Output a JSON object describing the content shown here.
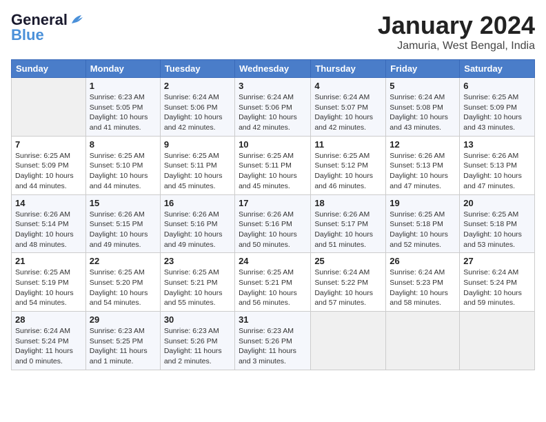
{
  "logo": {
    "line1": "General",
    "line2": "Blue"
  },
  "title": "January 2024",
  "location": "Jamuria, West Bengal, India",
  "headers": [
    "Sunday",
    "Monday",
    "Tuesday",
    "Wednesday",
    "Thursday",
    "Friday",
    "Saturday"
  ],
  "weeks": [
    [
      {
        "day": "",
        "info": ""
      },
      {
        "day": "1",
        "info": "Sunrise: 6:23 AM\nSunset: 5:05 PM\nDaylight: 10 hours\nand 41 minutes."
      },
      {
        "day": "2",
        "info": "Sunrise: 6:24 AM\nSunset: 5:06 PM\nDaylight: 10 hours\nand 42 minutes."
      },
      {
        "day": "3",
        "info": "Sunrise: 6:24 AM\nSunset: 5:06 PM\nDaylight: 10 hours\nand 42 minutes."
      },
      {
        "day": "4",
        "info": "Sunrise: 6:24 AM\nSunset: 5:07 PM\nDaylight: 10 hours\nand 42 minutes."
      },
      {
        "day": "5",
        "info": "Sunrise: 6:24 AM\nSunset: 5:08 PM\nDaylight: 10 hours\nand 43 minutes."
      },
      {
        "day": "6",
        "info": "Sunrise: 6:25 AM\nSunset: 5:09 PM\nDaylight: 10 hours\nand 43 minutes."
      }
    ],
    [
      {
        "day": "7",
        "info": "Sunrise: 6:25 AM\nSunset: 5:09 PM\nDaylight: 10 hours\nand 44 minutes."
      },
      {
        "day": "8",
        "info": "Sunrise: 6:25 AM\nSunset: 5:10 PM\nDaylight: 10 hours\nand 44 minutes."
      },
      {
        "day": "9",
        "info": "Sunrise: 6:25 AM\nSunset: 5:11 PM\nDaylight: 10 hours\nand 45 minutes."
      },
      {
        "day": "10",
        "info": "Sunrise: 6:25 AM\nSunset: 5:11 PM\nDaylight: 10 hours\nand 45 minutes."
      },
      {
        "day": "11",
        "info": "Sunrise: 6:25 AM\nSunset: 5:12 PM\nDaylight: 10 hours\nand 46 minutes."
      },
      {
        "day": "12",
        "info": "Sunrise: 6:26 AM\nSunset: 5:13 PM\nDaylight: 10 hours\nand 47 minutes."
      },
      {
        "day": "13",
        "info": "Sunrise: 6:26 AM\nSunset: 5:13 PM\nDaylight: 10 hours\nand 47 minutes."
      }
    ],
    [
      {
        "day": "14",
        "info": "Sunrise: 6:26 AM\nSunset: 5:14 PM\nDaylight: 10 hours\nand 48 minutes."
      },
      {
        "day": "15",
        "info": "Sunrise: 6:26 AM\nSunset: 5:15 PM\nDaylight: 10 hours\nand 49 minutes."
      },
      {
        "day": "16",
        "info": "Sunrise: 6:26 AM\nSunset: 5:16 PM\nDaylight: 10 hours\nand 49 minutes."
      },
      {
        "day": "17",
        "info": "Sunrise: 6:26 AM\nSunset: 5:16 PM\nDaylight: 10 hours\nand 50 minutes."
      },
      {
        "day": "18",
        "info": "Sunrise: 6:26 AM\nSunset: 5:17 PM\nDaylight: 10 hours\nand 51 minutes."
      },
      {
        "day": "19",
        "info": "Sunrise: 6:25 AM\nSunset: 5:18 PM\nDaylight: 10 hours\nand 52 minutes."
      },
      {
        "day": "20",
        "info": "Sunrise: 6:25 AM\nSunset: 5:18 PM\nDaylight: 10 hours\nand 53 minutes."
      }
    ],
    [
      {
        "day": "21",
        "info": "Sunrise: 6:25 AM\nSunset: 5:19 PM\nDaylight: 10 hours\nand 54 minutes."
      },
      {
        "day": "22",
        "info": "Sunrise: 6:25 AM\nSunset: 5:20 PM\nDaylight: 10 hours\nand 54 minutes."
      },
      {
        "day": "23",
        "info": "Sunrise: 6:25 AM\nSunset: 5:21 PM\nDaylight: 10 hours\nand 55 minutes."
      },
      {
        "day": "24",
        "info": "Sunrise: 6:25 AM\nSunset: 5:21 PM\nDaylight: 10 hours\nand 56 minutes."
      },
      {
        "day": "25",
        "info": "Sunrise: 6:24 AM\nSunset: 5:22 PM\nDaylight: 10 hours\nand 57 minutes."
      },
      {
        "day": "26",
        "info": "Sunrise: 6:24 AM\nSunset: 5:23 PM\nDaylight: 10 hours\nand 58 minutes."
      },
      {
        "day": "27",
        "info": "Sunrise: 6:24 AM\nSunset: 5:24 PM\nDaylight: 10 hours\nand 59 minutes."
      }
    ],
    [
      {
        "day": "28",
        "info": "Sunrise: 6:24 AM\nSunset: 5:24 PM\nDaylight: 11 hours\nand 0 minutes."
      },
      {
        "day": "29",
        "info": "Sunrise: 6:23 AM\nSunset: 5:25 PM\nDaylight: 11 hours\nand 1 minute."
      },
      {
        "day": "30",
        "info": "Sunrise: 6:23 AM\nSunset: 5:26 PM\nDaylight: 11 hours\nand 2 minutes."
      },
      {
        "day": "31",
        "info": "Sunrise: 6:23 AM\nSunset: 5:26 PM\nDaylight: 11 hours\nand 3 minutes."
      },
      {
        "day": "",
        "info": ""
      },
      {
        "day": "",
        "info": ""
      },
      {
        "day": "",
        "info": ""
      }
    ]
  ]
}
